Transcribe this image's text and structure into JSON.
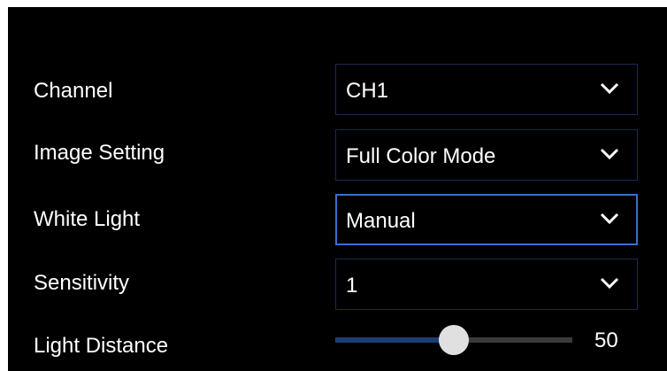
{
  "settings": {
    "channel": {
      "label": "Channel",
      "value": "CH1"
    },
    "image_setting": {
      "label": "Image Setting",
      "value": "Full Color Mode"
    },
    "white_light": {
      "label": "White Light",
      "value": "Manual"
    },
    "sensitivity": {
      "label": "Sensitivity",
      "value": "1"
    },
    "light_distance": {
      "label": "Light Distance",
      "value": "50",
      "max": 100
    }
  },
  "icons": {
    "dropdown": "chevron-down-icon"
  },
  "colors": {
    "background": "#000000",
    "text": "#ffffff",
    "dropdown_border": "#1b2a52",
    "focused_border": "#3a6fd0",
    "slider_fill": "#1d3d74",
    "slider_track": "#3b3b3b",
    "slider_thumb": "#e0e0e0"
  }
}
